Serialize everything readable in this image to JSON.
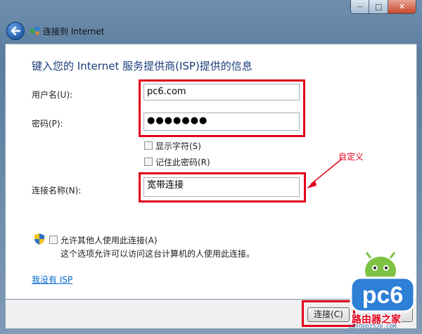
{
  "window": {
    "title": "连接到 Internet",
    "controls": {
      "minimize": "—",
      "maximize": "□",
      "close": "✕"
    }
  },
  "heading": "键入您的 Internet 服务提供商(ISP)提供的信息",
  "form": {
    "username_label": "用户名(U):",
    "username_value": "pc6.com",
    "password_label": "密码(P):",
    "password_value": "●●●●●●●",
    "show_chars_label": "显示字符(S)",
    "remember_label": "记住此密码(R)",
    "conn_name_label": "连接名称(N):",
    "conn_name_value": "宽带连接",
    "allow_others_label": "允许其他人使用此连接(A)",
    "allow_others_desc": "这个选项允许可以访问这台计算机的人使用此连接。"
  },
  "annotation": "自定义",
  "no_isp_link": "我没有 ISP",
  "footer": {
    "connect_button": "连接(C)"
  },
  "watermark": {
    "brand": "pc6",
    "site_name": "路由器之家",
    "site_url": "LUYOUQI520.COM"
  },
  "colors": {
    "highlight": "#e2001a",
    "heading": "#1a3e7a",
    "link": "#0066cc"
  }
}
